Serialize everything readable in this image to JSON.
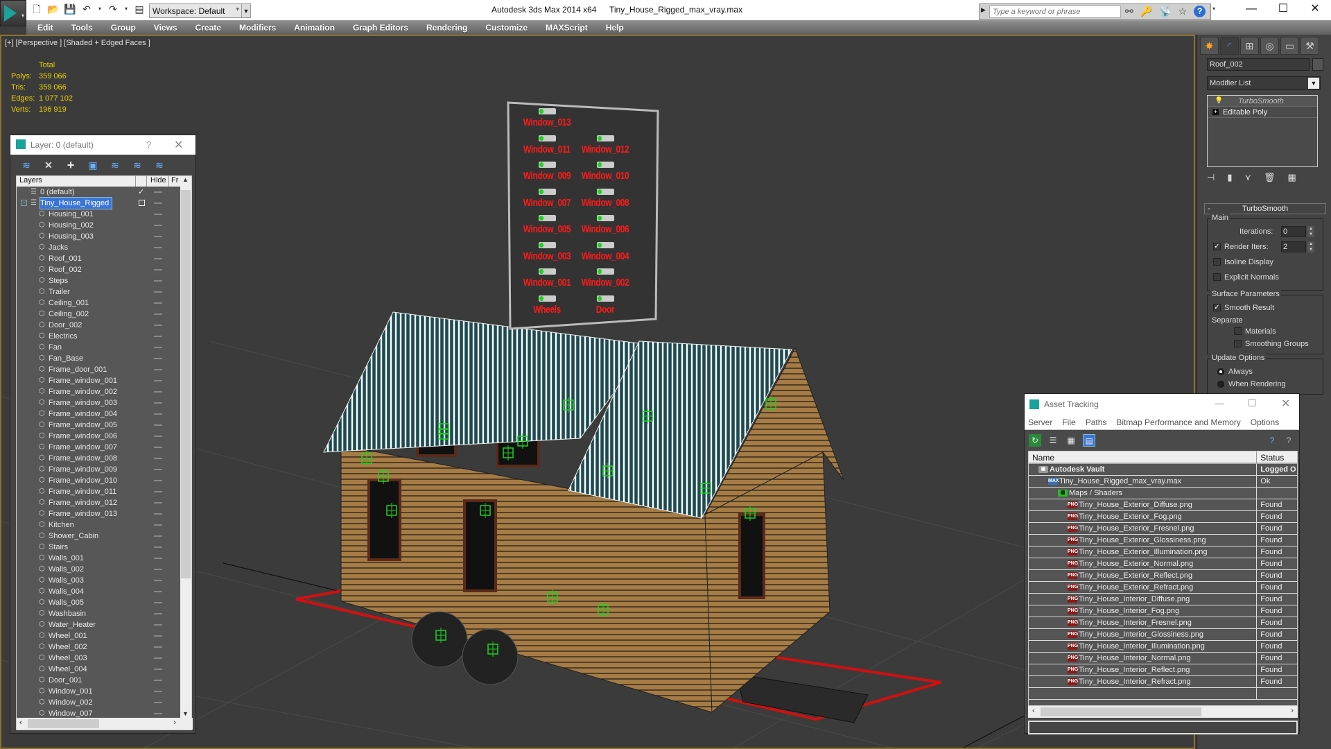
{
  "app": {
    "title": "Autodesk 3ds Max  2014 x64",
    "file": "Tiny_House_Rigged_max_vray.max",
    "workspace": "Workspace: Default",
    "search_placeholder": "Type a keyword or phrase"
  },
  "menu": [
    "Edit",
    "Tools",
    "Group",
    "Views",
    "Create",
    "Modifiers",
    "Animation",
    "Graph Editors",
    "Rendering",
    "Customize",
    "MAXScript",
    "Help"
  ],
  "viewport": {
    "label": "[+] [Perspective ] [Shaded + Edged Faces ]",
    "stats": {
      "header": "Total",
      "rows": [
        {
          "label": "Polys:",
          "value": "359 066"
        },
        {
          "label": "Tris:",
          "value": "359 066"
        },
        {
          "label": "Edges:",
          "value": "1 077 102"
        },
        {
          "label": "Verts:",
          "value": "196 919"
        }
      ]
    },
    "control_board": {
      "items": [
        {
          "label": "Window_013",
          "col": 0,
          "row": 0
        },
        {
          "label": "Window_011",
          "col": 0,
          "row": 1
        },
        {
          "label": "Window_012",
          "col": 1,
          "row": 1
        },
        {
          "label": "Window_009",
          "col": 0,
          "row": 2
        },
        {
          "label": "Window_010",
          "col": 1,
          "row": 2
        },
        {
          "label": "Window_007",
          "col": 0,
          "row": 3
        },
        {
          "label": "Window_008",
          "col": 1,
          "row": 3
        },
        {
          "label": "Window_005",
          "col": 0,
          "row": 4
        },
        {
          "label": "Window_006",
          "col": 1,
          "row": 4
        },
        {
          "label": "Window_003",
          "col": 0,
          "row": 5
        },
        {
          "label": "Window_004",
          "col": 1,
          "row": 5
        },
        {
          "label": "Window_001",
          "col": 0,
          "row": 6
        },
        {
          "label": "Window_002",
          "col": 1,
          "row": 6
        },
        {
          "label": "Wheels",
          "col": 0,
          "row": 7
        },
        {
          "label": "Door",
          "col": 1,
          "row": 7
        }
      ]
    }
  },
  "layer_dialog": {
    "title": "Layer: 0 (default)",
    "help": "?",
    "columns": {
      "layers": "Layers",
      "hide": "Hide",
      "freeze": "Fr"
    },
    "layers": [
      {
        "name": "0 (default)",
        "level": 0,
        "type": "layer",
        "current": true
      },
      {
        "name": "Tiny_House_Rigged",
        "level": 0,
        "type": "layer",
        "selected": true,
        "expanded": true
      },
      {
        "name": "Housing_001",
        "level": 1,
        "type": "object"
      },
      {
        "name": "Housing_002",
        "level": 1,
        "type": "object"
      },
      {
        "name": "Housing_003",
        "level": 1,
        "type": "object"
      },
      {
        "name": "Jacks",
        "level": 1,
        "type": "object"
      },
      {
        "name": "Roof_001",
        "level": 1,
        "type": "object"
      },
      {
        "name": "Roof_002",
        "level": 1,
        "type": "object"
      },
      {
        "name": "Steps",
        "level": 1,
        "type": "object"
      },
      {
        "name": "Trailer",
        "level": 1,
        "type": "object"
      },
      {
        "name": "Ceiling_001",
        "level": 1,
        "type": "object"
      },
      {
        "name": "Ceiling_002",
        "level": 1,
        "type": "object"
      },
      {
        "name": "Door_002",
        "level": 1,
        "type": "object"
      },
      {
        "name": "Electrics",
        "level": 1,
        "type": "object"
      },
      {
        "name": "Fan",
        "level": 1,
        "type": "object"
      },
      {
        "name": "Fan_Base",
        "level": 1,
        "type": "object"
      },
      {
        "name": "Frame_door_001",
        "level": 1,
        "type": "object"
      },
      {
        "name": "Frame_window_001",
        "level": 1,
        "type": "object"
      },
      {
        "name": "Frame_window_002",
        "level": 1,
        "type": "object"
      },
      {
        "name": "Frame_window_003",
        "level": 1,
        "type": "object"
      },
      {
        "name": "Frame_window_004",
        "level": 1,
        "type": "object"
      },
      {
        "name": "Frame_window_005",
        "level": 1,
        "type": "object"
      },
      {
        "name": "Frame_window_006",
        "level": 1,
        "type": "object"
      },
      {
        "name": "Frame_window_007",
        "level": 1,
        "type": "object"
      },
      {
        "name": "Frame_window_008",
        "level": 1,
        "type": "object"
      },
      {
        "name": "Frame_window_009",
        "level": 1,
        "type": "object"
      },
      {
        "name": "Frame_window_010",
        "level": 1,
        "type": "object"
      },
      {
        "name": "Frame_window_011",
        "level": 1,
        "type": "object"
      },
      {
        "name": "Frame_window_012",
        "level": 1,
        "type": "object"
      },
      {
        "name": "Frame_window_013",
        "level": 1,
        "type": "object"
      },
      {
        "name": "Kitchen",
        "level": 1,
        "type": "object"
      },
      {
        "name": "Shower_Cabin",
        "level": 1,
        "type": "object"
      },
      {
        "name": "Stairs",
        "level": 1,
        "type": "object"
      },
      {
        "name": "Walls_001",
        "level": 1,
        "type": "object"
      },
      {
        "name": "Walls_002",
        "level": 1,
        "type": "object"
      },
      {
        "name": "Walls_003",
        "level": 1,
        "type": "object"
      },
      {
        "name": "Walls_004",
        "level": 1,
        "type": "object"
      },
      {
        "name": "Walls_005",
        "level": 1,
        "type": "object"
      },
      {
        "name": "Washbasin",
        "level": 1,
        "type": "object"
      },
      {
        "name": "Water_Heater",
        "level": 1,
        "type": "object"
      },
      {
        "name": "Wheel_001",
        "level": 1,
        "type": "object"
      },
      {
        "name": "Wheel_002",
        "level": 1,
        "type": "object"
      },
      {
        "name": "Wheel_003",
        "level": 1,
        "type": "object"
      },
      {
        "name": "Wheel_004",
        "level": 1,
        "type": "object"
      },
      {
        "name": "Door_001",
        "level": 1,
        "type": "object"
      },
      {
        "name": "Window_001",
        "level": 1,
        "type": "object"
      },
      {
        "name": "Window_002",
        "level": 1,
        "type": "object"
      },
      {
        "name": "Window_007",
        "level": 1,
        "type": "object"
      }
    ]
  },
  "command_panel": {
    "object_name": "Roof_002",
    "modifier_list": "Modifier List",
    "stack": [
      {
        "name": "TurboSmooth",
        "type": "modifier"
      },
      {
        "name": "Editable Poly",
        "type": "base"
      }
    ],
    "turbosmooth": {
      "title": "TurboSmooth",
      "main_label": "Main",
      "iterations_label": "Iterations:",
      "iterations": "0",
      "render_iters_label": "Render Iters:",
      "render_iters": "2",
      "render_iters_checked": true,
      "isoline_label": "Isoline Display",
      "isoline_checked": false,
      "explicit_normals_label": "Explicit Normals",
      "explicit_normals_checked": false,
      "surface_label": "Surface Parameters",
      "smooth_result_label": "Smooth Result",
      "smooth_result_checked": true,
      "separate_label": "Separate",
      "materials_label": "Materials",
      "materials_checked": false,
      "smoothing_groups_label": "Smoothing Groups",
      "smoothing_groups_checked": false,
      "update_label": "Update Options",
      "always_label": "Always",
      "when_rendering_label": "When Rendering",
      "update_mode": "Always"
    }
  },
  "asset_tracking": {
    "title": "Asset Tracking",
    "menu": [
      "Server",
      "File",
      "Paths",
      "Bitmap Performance and Memory",
      "Options"
    ],
    "columns": {
      "name": "Name",
      "status": "Status"
    },
    "rows": [
      {
        "name": "Autodesk Vault",
        "status": "Logged O",
        "level": 0,
        "icon": "vault",
        "bold": true
      },
      {
        "name": "Tiny_House_Rigged_max_vray.max",
        "status": "Ok",
        "level": 1,
        "icon": "max"
      },
      {
        "name": "Maps / Shaders",
        "status": "",
        "level": 2,
        "icon": "maps"
      },
      {
        "name": "Tiny_House_Exterior_Diffuse.png",
        "status": "Found",
        "level": 3,
        "icon": "png"
      },
      {
        "name": "Tiny_House_Exterior_Fog.png",
        "status": "Found",
        "level": 3,
        "icon": "png"
      },
      {
        "name": "Tiny_House_Exterior_Fresnel.png",
        "status": "Found",
        "level": 3,
        "icon": "png"
      },
      {
        "name": "Tiny_House_Exterior_Glossiness.png",
        "status": "Found",
        "level": 3,
        "icon": "png"
      },
      {
        "name": "Tiny_House_Exterior_Illumination.png",
        "status": "Found",
        "level": 3,
        "icon": "png"
      },
      {
        "name": "Tiny_House_Exterior_Normal.png",
        "status": "Found",
        "level": 3,
        "icon": "png"
      },
      {
        "name": "Tiny_House_Exterior_Reflect.png",
        "status": "Found",
        "level": 3,
        "icon": "png"
      },
      {
        "name": "Tiny_House_Exterior_Refract.png",
        "status": "Found",
        "level": 3,
        "icon": "png"
      },
      {
        "name": "Tiny_House_Interior_Diffuse.png",
        "status": "Found",
        "level": 3,
        "icon": "png"
      },
      {
        "name": "Tiny_House_Interior_Fog.png",
        "status": "Found",
        "level": 3,
        "icon": "png"
      },
      {
        "name": "Tiny_House_Interior_Fresnel.png",
        "status": "Found",
        "level": 3,
        "icon": "png"
      },
      {
        "name": "Tiny_House_Interior_Glossiness.png",
        "status": "Found",
        "level": 3,
        "icon": "png"
      },
      {
        "name": "Tiny_House_Interior_Illumination.png",
        "status": "Found",
        "level": 3,
        "icon": "png"
      },
      {
        "name": "Tiny_House_Interior_Normal.png",
        "status": "Found",
        "level": 3,
        "icon": "png"
      },
      {
        "name": "Tiny_House_Interior_Reflect.png",
        "status": "Found",
        "level": 3,
        "icon": "png"
      },
      {
        "name": "Tiny_House_Interior_Refract.png",
        "status": "Found",
        "level": 3,
        "icon": "png"
      }
    ]
  },
  "colors": {
    "accent": "#3875d7",
    "viewport_border": "#8a7230",
    "stats_text": "#e8d000",
    "control_label": "#ff1a1a",
    "helper_green": "#1ed21e",
    "selection_box": "#d01010",
    "wood": "#a57c45",
    "roof": "#1d4a52"
  }
}
